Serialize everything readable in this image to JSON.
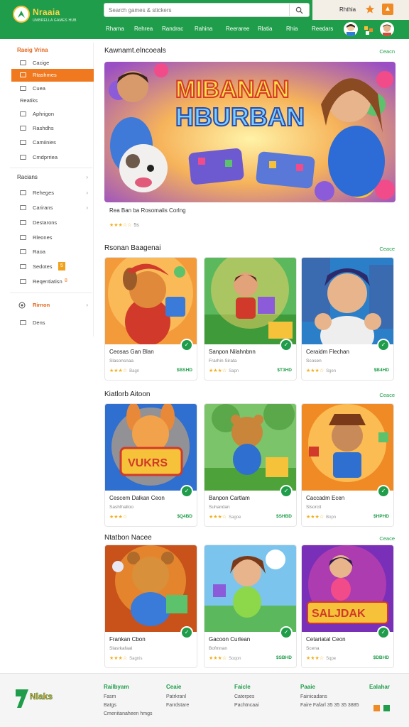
{
  "header": {
    "logo_text": "Nraaia",
    "logo_sub": "UMBRELLA GAMES HUB",
    "search_placeholder": "Search games & stickers",
    "login": "Rhthia",
    "nav": [
      "Rhama",
      "Rehrea",
      "Randrac",
      "Rahina",
      "Reeraree",
      "Rlatia",
      "Rhia",
      "Reedars"
    ]
  },
  "sidebar": {
    "heading": "Raeig Vrina",
    "items": [
      {
        "label": "Cacige",
        "active": false
      },
      {
        "label": "Rtashmes",
        "active": true
      },
      {
        "label": "Cuea",
        "active": false
      },
      {
        "label": "Reatiks",
        "active": false
      },
      {
        "label": "Aphrigon",
        "active": false
      },
      {
        "label": "Rashdhs",
        "active": false
      },
      {
        "label": "Camiinies",
        "active": false
      },
      {
        "label": "Cmdprriea",
        "active": false
      }
    ],
    "section2": "Racians",
    "items2": [
      {
        "label": "Reheges",
        "tag": ""
      },
      {
        "label": "Carirans",
        "tag": ""
      },
      {
        "label": "Destarons",
        "tag": ""
      },
      {
        "label": "Rleones",
        "tag": ""
      },
      {
        "label": "Raoa",
        "tag": ""
      },
      {
        "label": "Sedotes",
        "tag": "5"
      },
      {
        "label": "Reqentiatisn",
        "tag": "8"
      }
    ],
    "section3": "Rirnon",
    "item3": "Dens"
  },
  "featured": {
    "title": "Kawnamt.elncoeals",
    "see_all": "Ceacn",
    "hero_text_line1": "MIBANAN",
    "hero_text_line2": "HBURBAN",
    "caption": "Rea Ban ba Rosomalis Corlng",
    "rating_count": "5s"
  },
  "sections": [
    {
      "title": "Rsonan Baagenai",
      "see_all": "Ceace",
      "cards": [
        {
          "title": "Ceosas Gan Blan",
          "sub": "Slasonsnaa",
          "count": "Bagn",
          "price": "$BSHD"
        },
        {
          "title": "Sanpon Nilahnbnn",
          "sub": "Frarhin Sirata",
          "count": "Sapn",
          "price": "$T3HD"
        },
        {
          "title": "Ceraidm Flechan",
          "sub": "Scosen",
          "count": "Sgen",
          "price": "$B4HD"
        }
      ]
    },
    {
      "title": "Kiatlorb Aitoon",
      "see_all": "Ceace",
      "cards": [
        {
          "title": "Cescem Dalkan Ceon",
          "sub": "Sashfnalloo",
          "count": "",
          "price": "$Q4BD"
        },
        {
          "title": "Banpon Cartlam",
          "sub": "Suhandan",
          "count": "Sagoe",
          "price": "$SHBD"
        },
        {
          "title": "Caccadm Ecen",
          "sub": "Slsorcit",
          "count": "Bopn",
          "price": "$HPHD"
        }
      ]
    },
    {
      "title": "Ntatbon Nacee",
      "see_all": "Ceace",
      "cards": [
        {
          "title": "Frankan Cbon",
          "sub": "Slasrkafaal",
          "count": "Sagnis",
          "price": ""
        },
        {
          "title": "Gacoon Curlean",
          "sub": "Bofmnan",
          "count": "Soqon",
          "price": "$SBHD"
        },
        {
          "title": "Cetariatal Ceon",
          "sub": "Scena",
          "count": "Sqpe",
          "price": "$DBHD"
        }
      ]
    }
  ],
  "footer": {
    "logo_text": "Nlaks",
    "cols": [
      {
        "head": "Railbyam",
        "links": [
          "Fasm",
          "Batgs",
          "Cmenitanaheen hmgs"
        ]
      },
      {
        "head": "Ceaie",
        "links": [
          "Patrkranl",
          "Farrdstare"
        ]
      },
      {
        "head": "Faicle",
        "links": [
          "Caterpes",
          "Pachtncaai"
        ]
      },
      {
        "head": "Paaie",
        "links": [
          "Fainicadans",
          "Faire Fafarl 35 35 35 3885"
        ]
      },
      {
        "head": "Ealahar",
        "links": []
      }
    ]
  },
  "colors": {
    "brand_green": "#1f9d4a",
    "accent_orange": "#f0781f",
    "star": "#f2b01e"
  }
}
